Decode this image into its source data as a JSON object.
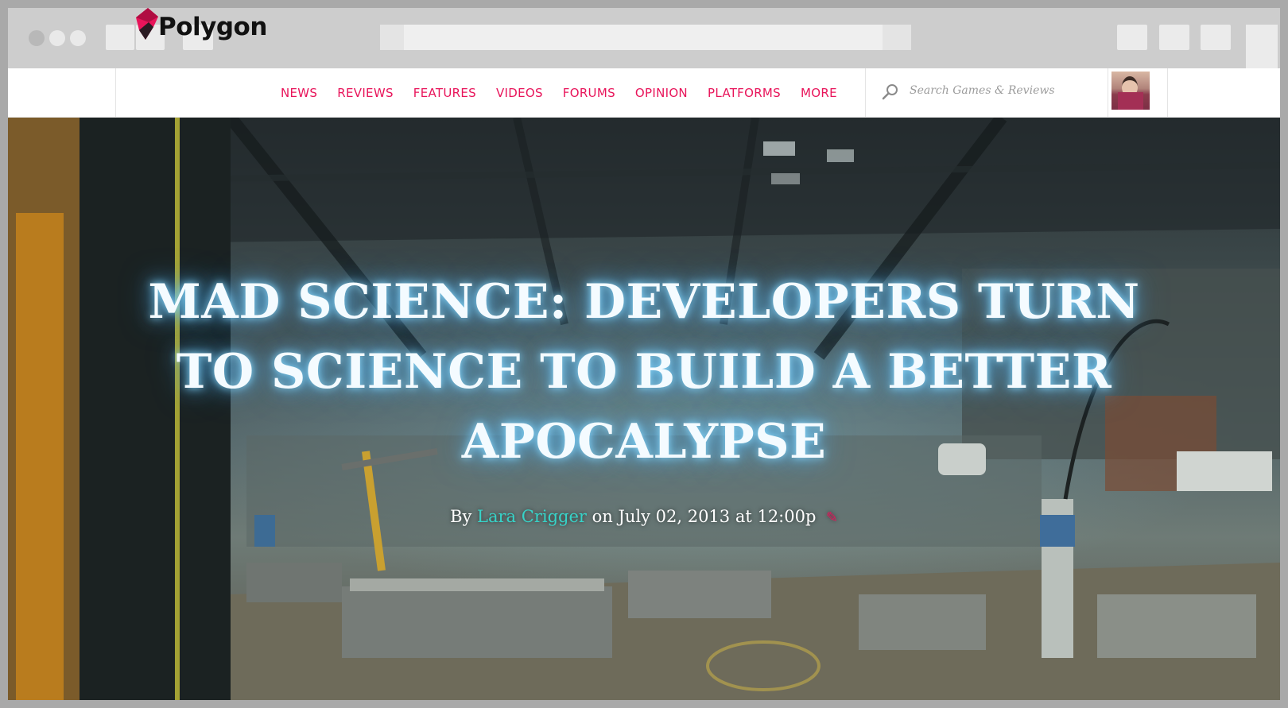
{
  "site": {
    "logo_text": "Polygon",
    "brand_color": "#e8145a",
    "nav": [
      "NEWS",
      "REVIEWS",
      "FEATURES",
      "VIDEOS",
      "FORUMS",
      "OPINION",
      "PLATFORMS",
      "MORE"
    ],
    "search_placeholder": "Search Games & Reviews"
  },
  "article": {
    "headline": "MAD SCIENCE: DEVELOPERS TURN TO SCIENCE TO BUILD A BETTER APOCALYPSE",
    "byline_prefix": "By ",
    "author": "Lara Crigger",
    "date_text": " on July 02, 2013 at 12:00p",
    "author_color": "#37d3c8"
  },
  "icons": [
    "polygon-logo-icon",
    "search-icon",
    "pencil-icon",
    "avatar"
  ]
}
